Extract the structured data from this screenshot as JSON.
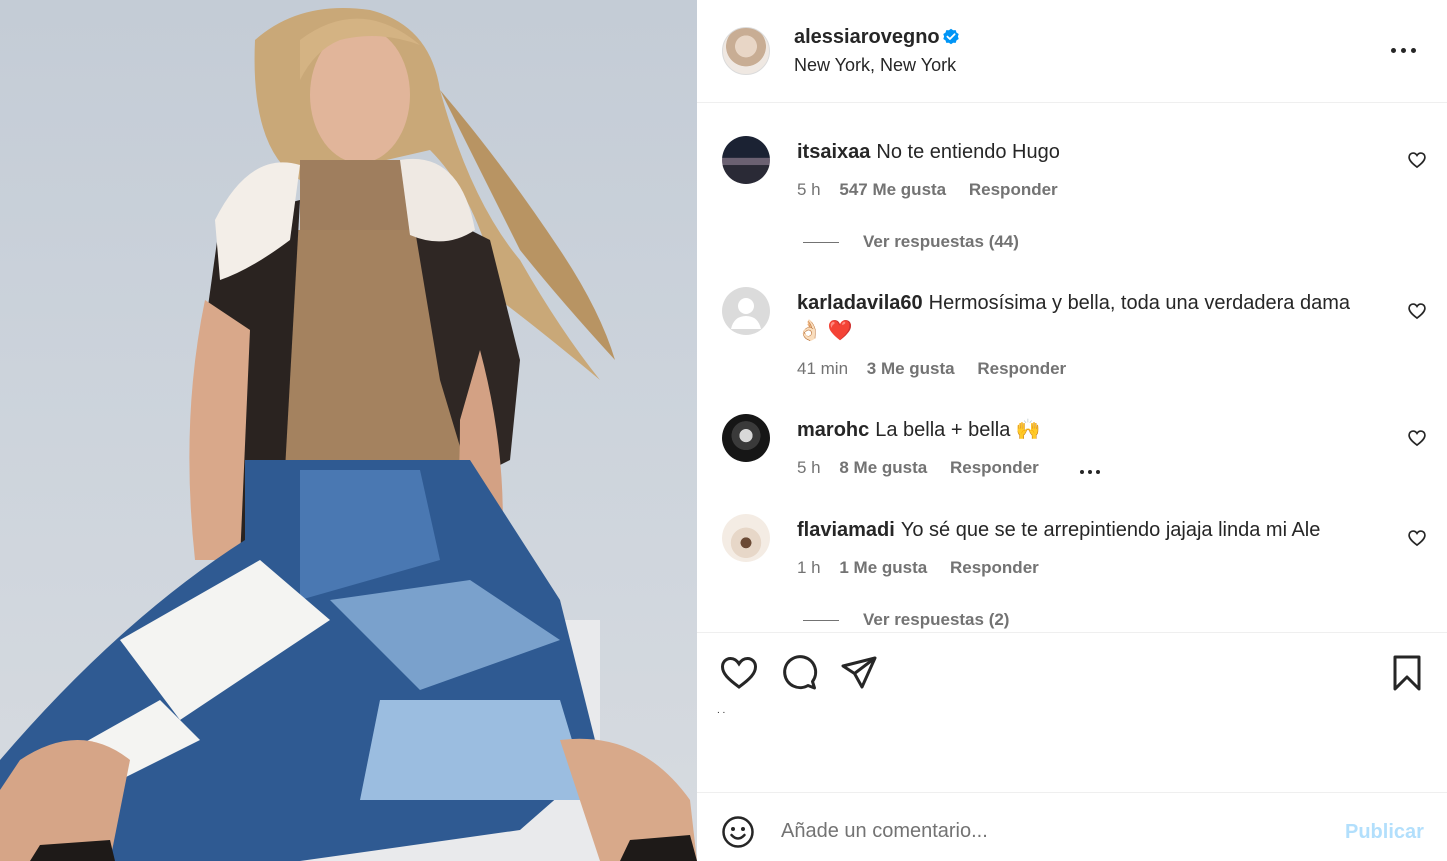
{
  "post": {
    "username": "alessiarovegno",
    "location": "New York, New York"
  },
  "comments": [
    {
      "user": "itsaixaa",
      "text": "No te entiendo Hugo",
      "time": "5 h",
      "likes": "547 Me gusta",
      "reply": "Responder",
      "view_replies": "Ver respuestas (44)"
    },
    {
      "user": "karladavila60",
      "text": "Hermosísima y bella, toda una verdadera dama",
      "emojis": "👌🏻 ❤️",
      "time": "41 min",
      "likes": "3 Me gusta",
      "reply": "Responder"
    },
    {
      "user": "marohc",
      "text": "La bella + bella 🙌",
      "time": "5 h",
      "likes": "8 Me gusta",
      "reply": "Responder"
    },
    {
      "user": "flaviamadi",
      "text": "Yo sé que se te arrepintiendo jajaja linda mi Ale",
      "time": "1 h",
      "likes": "1 Me gusta",
      "reply": "Responder",
      "view_replies": "Ver respuestas (2)"
    }
  ],
  "actions": {
    "like_icon": "heart-icon",
    "comment_icon": "comment-icon",
    "share_icon": "share-icon",
    "save_icon": "bookmark-icon",
    "tiny_text": ". ."
  },
  "comment_box": {
    "placeholder": "Añade un comentario...",
    "publish_label": "Publicar"
  },
  "colors": {
    "verified": "#0095f6",
    "publish_disabled": "#b2dffc",
    "secondary_text": "#737373"
  }
}
